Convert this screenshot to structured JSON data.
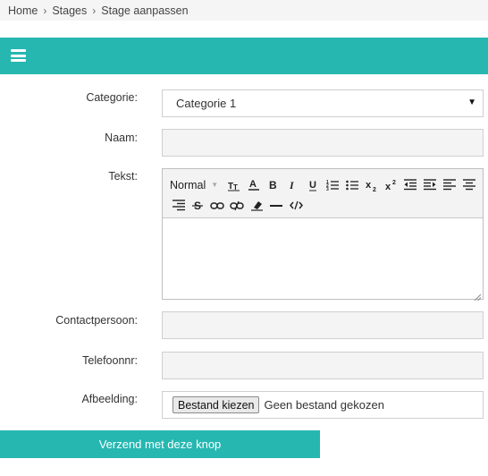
{
  "breadcrumb": {
    "items": [
      "Home",
      "Stages",
      "Stage aanpassen"
    ],
    "separator": "›"
  },
  "topbar": {
    "menu_icon": "hamburger-menu-icon",
    "color": "#26b7b1"
  },
  "form": {
    "categorie": {
      "label": "Categorie:",
      "value": "Categorie 1"
    },
    "naam": {
      "label": "Naam:",
      "value": ""
    },
    "tekst": {
      "label": "Tekst:",
      "format_value": "Normal",
      "toolbar_icons": [
        "text-size-icon",
        "font-color-icon",
        "bold-icon",
        "italic-icon",
        "underline-icon",
        "ordered-list-icon",
        "unordered-list-icon",
        "subscript-icon",
        "superscript-icon",
        "outdent-icon",
        "indent-icon",
        "align-left-icon",
        "align-center-icon",
        "align-right-icon",
        "strikethrough-icon",
        "link-icon",
        "unlink-icon",
        "clear-format-icon",
        "horizontal-rule-icon",
        "code-icon"
      ],
      "value": ""
    },
    "contactpersoon": {
      "label": "Contactpersoon:",
      "value": ""
    },
    "telefoonnr": {
      "label": "Telefoonnr:",
      "value": ""
    },
    "afbeelding": {
      "label": "Afbeelding:",
      "button": "Bestand kiezen",
      "status": "Geen bestand gekozen"
    }
  },
  "submit": {
    "label": "Verzend met deze knop"
  }
}
